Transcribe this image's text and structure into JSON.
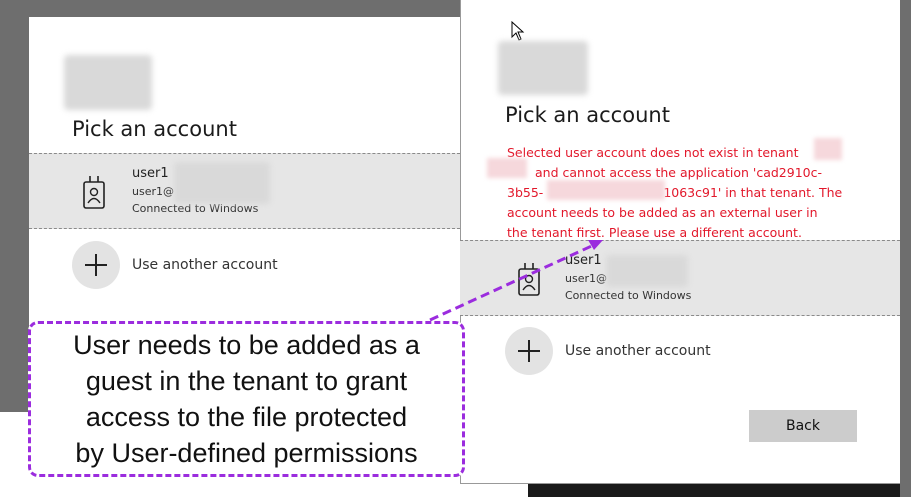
{
  "left_dialog": {
    "title": "Pick an account",
    "account": {
      "name": "user1",
      "email": "user1@",
      "status": "Connected to Windows"
    },
    "use_another": "Use another account"
  },
  "right_dialog": {
    "title": "Pick an account",
    "error_lines": [
      "Selected user account does not exist in tenant",
      "and cannot access the application 'cad2910c-",
      "3b55-",
      "1063c91' in that tenant. The",
      "account needs to be added as an external user in",
      "the tenant first. Please use a different account."
    ],
    "account": {
      "name": "user1",
      "email": "user1@",
      "status": "Connected to Windows"
    },
    "use_another": "Use another account",
    "back_label": "Back"
  },
  "callout": {
    "lines": [
      "User needs to be added as a",
      "guest in the tenant to grant",
      "access to the file protected",
      "by User-defined permissions"
    ]
  },
  "colors": {
    "error": "#e2182b",
    "callout_border": "#9b2cde",
    "account_row_bg": "#e6e6e6"
  },
  "icons": [
    "user-badge-icon",
    "plus-icon",
    "mouse-cursor-icon",
    "pointer-arrow"
  ]
}
